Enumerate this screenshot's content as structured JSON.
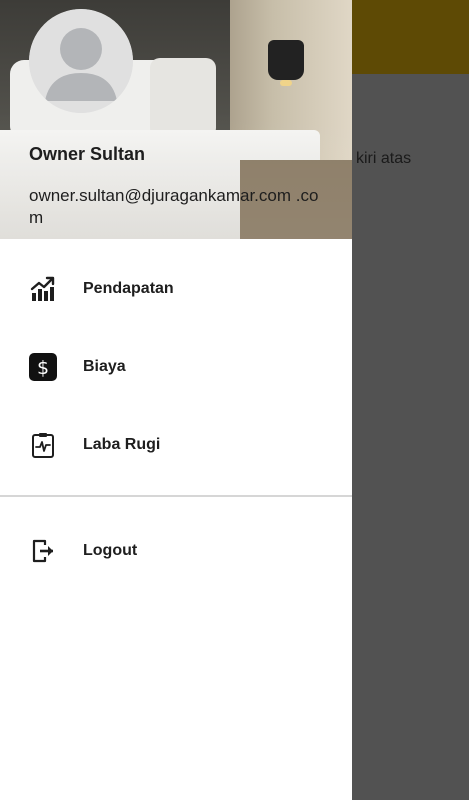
{
  "background_app": {
    "hint_text": "kiri atas"
  },
  "drawer": {
    "user": {
      "name": "Owner Sultan",
      "email": "owner.sultan@djuragankamar.com .com"
    },
    "menu": [
      {
        "label": "Pendapatan",
        "icon": "chart-up-icon"
      },
      {
        "label": "Biaya",
        "icon": "dollar-icon"
      },
      {
        "label": "Laba Rugi",
        "icon": "clipboard-pulse-icon"
      }
    ],
    "logout": {
      "label": "Logout",
      "icon": "logout-icon"
    }
  },
  "colors": {
    "app_bar": "#5e4a05",
    "scrim": "#525252",
    "drawer_bg": "#ffffff"
  }
}
